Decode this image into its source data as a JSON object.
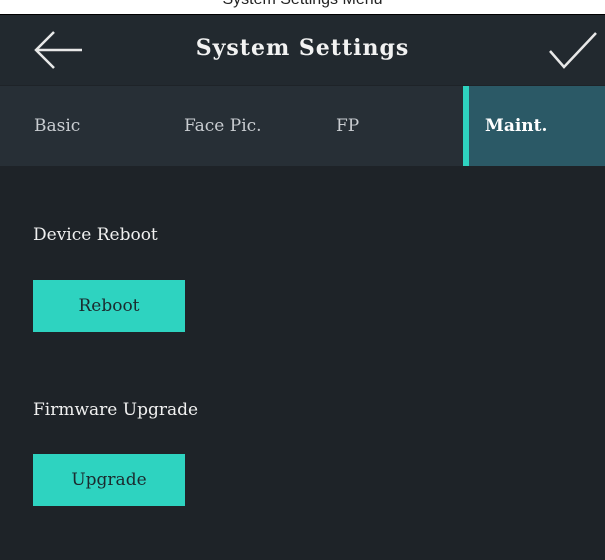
{
  "caption": {
    "text": "System Settings Menu"
  },
  "header": {
    "title": "System Settings",
    "back_icon": "arrow-left-icon",
    "confirm_icon": "checkmark-icon"
  },
  "tabs": [
    {
      "label": "Basic",
      "active": false
    },
    {
      "label": "Face Pic.",
      "active": false
    },
    {
      "label": "FP",
      "active": false
    },
    {
      "label": "Maint.",
      "active": true
    }
  ],
  "maintenance": {
    "reboot": {
      "label": "Device Reboot",
      "button": "Reboot"
    },
    "upgrade": {
      "label": "Firmware Upgrade",
      "button": "Upgrade"
    }
  },
  "colors": {
    "background": "#1e2328",
    "header": "#22292f",
    "tab_bar": "#272f36",
    "active_tab": "#2b5966",
    "accent": "#2ed3c0"
  }
}
